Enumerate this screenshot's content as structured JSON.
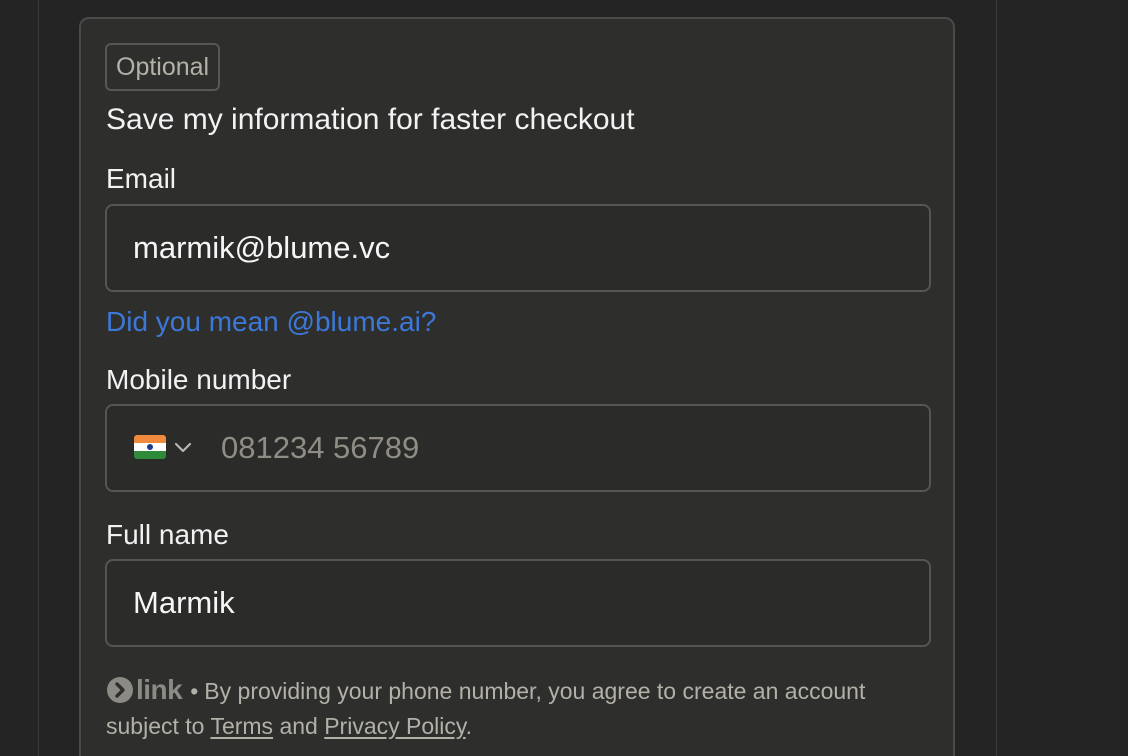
{
  "form": {
    "badge": "Optional",
    "heading": "Save my information for faster checkout",
    "email": {
      "label": "Email",
      "value": "marmik@blume.vc",
      "suggestion": "Did you mean @blume.ai?"
    },
    "mobile": {
      "label": "Mobile number",
      "country_flag": "india-flag-icon",
      "placeholder": "081234 56789"
    },
    "full_name": {
      "label": "Full name",
      "value": "Marmik"
    }
  },
  "footer": {
    "brand": "link",
    "separator": "•",
    "text_before": "By providing your phone number, you agree to create an account subject to",
    "terms": "Terms",
    "and": "and",
    "privacy": "Privacy Policy",
    "period": "."
  },
  "colors": {
    "background": "#242424",
    "card": "#2e2e2d",
    "link_blue": "#3c78d8",
    "text": "#f2f2f2",
    "muted": "#b2b0a7"
  }
}
